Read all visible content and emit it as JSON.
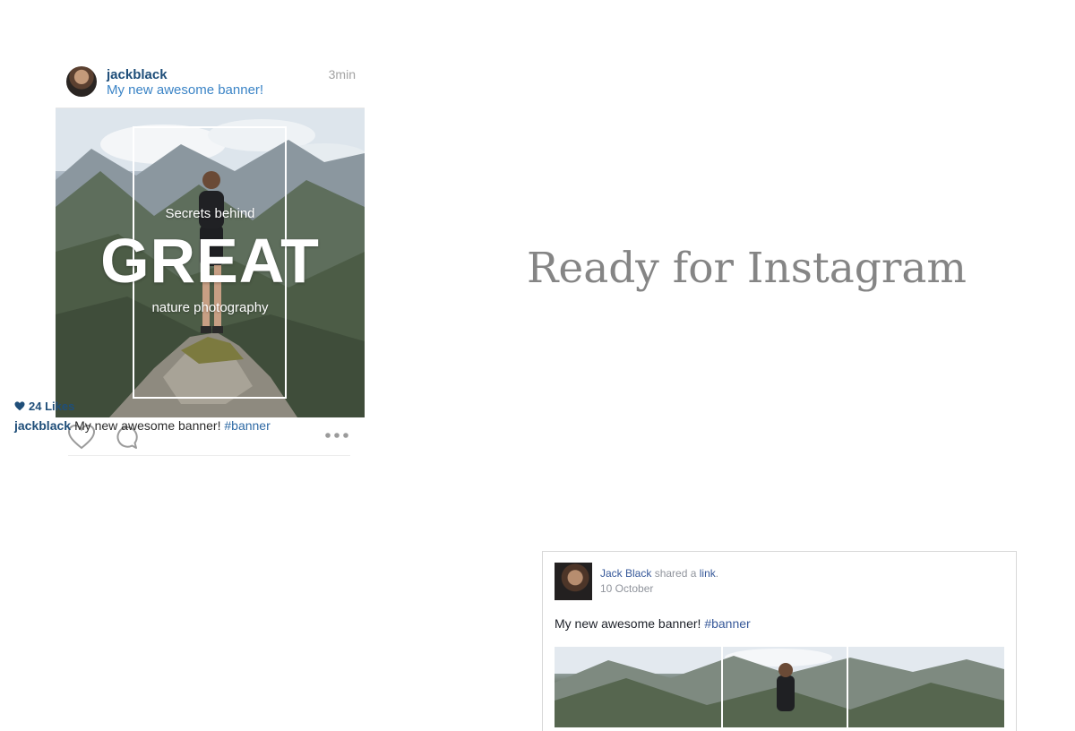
{
  "instagram": {
    "username": "jackblack",
    "header_caption": "My new awesome banner!",
    "time": "3min",
    "image": {
      "line1": "Secrets behind",
      "headline": "GREAT",
      "line3": "nature photography"
    },
    "likes": "24 Likes",
    "caption": {
      "user": "jackblack",
      "text": "My new awesome banner!",
      "hashtag": "#banner"
    }
  },
  "heading": "Ready for Instagram",
  "facebook": {
    "name": "Jack Black",
    "shared_text": "shared a",
    "link_text": "link",
    "period": ".",
    "date": "10 October",
    "post_text": "My new awesome banner!",
    "hashtag": "#banner"
  },
  "colors": {
    "ig_username": "#1f4e79",
    "ig_link": "#3b84c6",
    "fb_blue": "#365899",
    "heading": "#858585"
  },
  "icons": [
    "heart-icon",
    "comment-icon",
    "more-icon",
    "avatar"
  ]
}
